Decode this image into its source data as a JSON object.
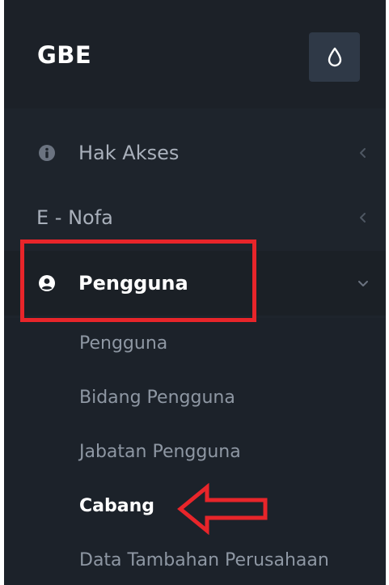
{
  "brand": "GBE",
  "header": {
    "theme_toggle_icon": "droplet-icon"
  },
  "menu": [
    {
      "label": "Hak Akses",
      "icon": "info-circle-icon",
      "expanded": false
    },
    {
      "label": "E - Nofa",
      "icon": null,
      "expanded": false
    },
    {
      "label": "Pengguna",
      "icon": "user-circle-icon",
      "expanded": true
    }
  ],
  "submenu": [
    {
      "label": "Pengguna"
    },
    {
      "label": "Bidang Pengguna"
    },
    {
      "label": "Jabatan Pengguna"
    },
    {
      "label": "Cabang"
    },
    {
      "label": "Data Tambahan Perusahaan"
    }
  ],
  "annotations": {
    "color": "#e8252a",
    "box_target": "Pengguna",
    "arrow_target": "Cabang"
  },
  "colors": {
    "sidebar_bg": "#1e242c",
    "header_bg": "#1c2128",
    "submenu_bg": "#1c222a",
    "text_muted": "#a9b0bb",
    "text_active": "#ffffff"
  }
}
